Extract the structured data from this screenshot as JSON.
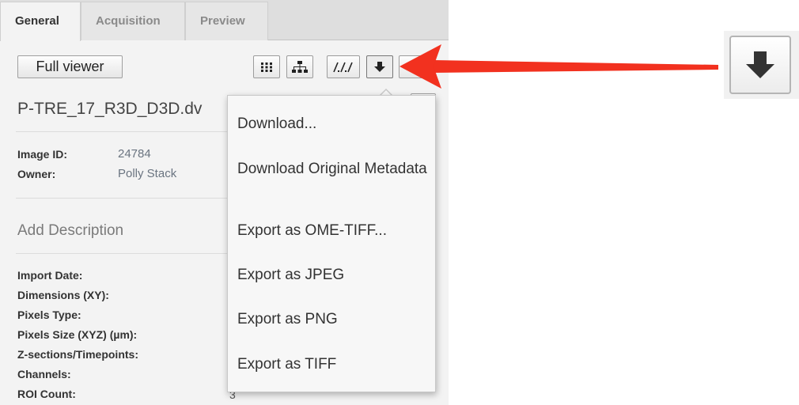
{
  "tabs": [
    {
      "label": "General",
      "active": true
    },
    {
      "label": "Acquisition",
      "active": false
    },
    {
      "label": "Preview",
      "active": false
    }
  ],
  "toolbar": {
    "full_viewer_label": "Full viewer",
    "icons": [
      "grid-icon",
      "hierarchy-icon",
      "link-icon",
      "download-icon",
      "more-icon"
    ]
  },
  "image": {
    "name": "P-TRE_17_R3D_D3D.dv",
    "id_label": "Image ID:",
    "id_value": "24784",
    "owner_label": "Owner:",
    "owner_value": "Polly Stack"
  },
  "description": {
    "placeholder": "Add Description"
  },
  "metadata": {
    "labels": [
      "Import Date:",
      "Dimensions (XY):",
      "Pixels Type:",
      "Pixels Size (XYZ) (µm):",
      "Z-sections/Timepoints:",
      "Channels:",
      "ROI Count:"
    ],
    "roi_count_value": "3"
  },
  "download_menu": {
    "items": [
      "Download...",
      "Download Original Metadata",
      "Export as OME-TIFF...",
      "Export as JPEG",
      "Export as PNG",
      "Export as TIFF"
    ]
  },
  "colors": {
    "annotation_arrow": "#f2311f",
    "panel_bg": "#f3f3f3",
    "value_text": "#6a7480"
  }
}
